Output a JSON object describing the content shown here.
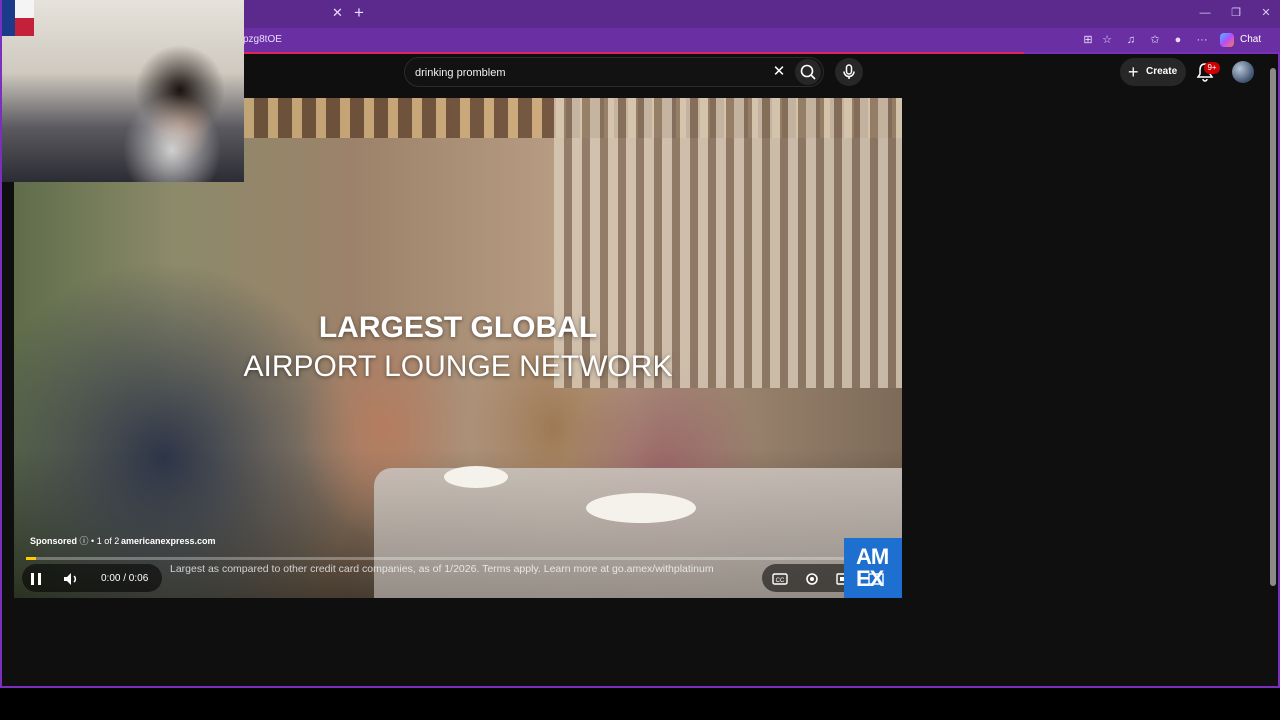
{
  "browser": {
    "url_fragment": "pzg8tOE",
    "chat_label": "Chat",
    "more_label": "···"
  },
  "header": {
    "search_value": "drinking promblem",
    "create_label": "Create",
    "notification_badge": "9+"
  },
  "ad": {
    "headline_line1": "LARGEST GLOBAL",
    "headline_line2": "AIRPORT LOUNGE NETWORK",
    "sponsored_label": "Sponsored",
    "ad_count": "• 1 of 2",
    "domain": "americanexpress.com",
    "disclaimer": "Largest as compared to other credit card companies, as of 1/2026. Terms apply. Learn more at go.amex/withplatinum",
    "time": "0:00 / 0:06",
    "progress_fraction": 0.012,
    "brand_logo_text": "AM EX",
    "brand_color": "#1d6fd0"
  },
  "colors": {
    "browser_accent": "#7b2fbf",
    "progress": "#ffcc00",
    "badge": "#cc0000"
  }
}
